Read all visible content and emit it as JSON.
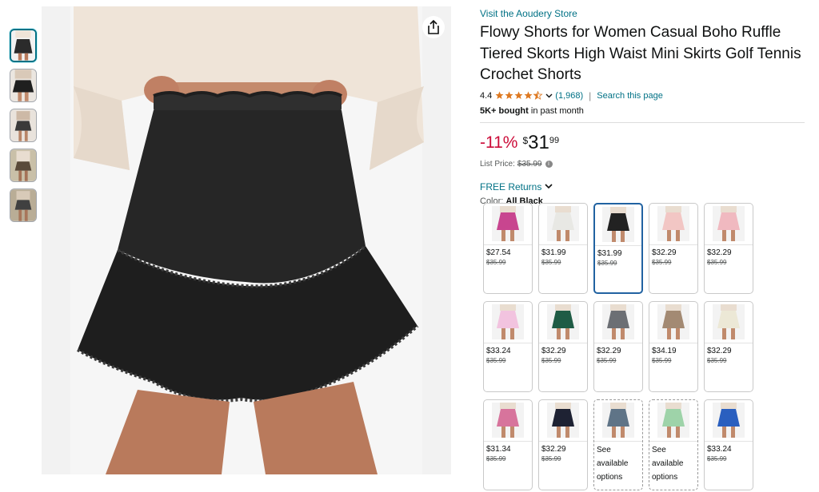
{
  "thumbnails": [
    {
      "color": "#2b2b2b"
    },
    {
      "color": "#1f1f1f"
    },
    {
      "color": "#3a3a3a"
    },
    {
      "color": "#5a4a3a"
    },
    {
      "color": "#404040"
    }
  ],
  "main_image": {
    "skirt_color": "#262626",
    "top_color": "#efe4d8",
    "skin_color": "#b97a5c",
    "bg_color": "#f2f2f2"
  },
  "product": {
    "store_link": "Visit the Aoudery Store",
    "title": "Flowy Shorts for Women Casual Boho Ruffle Tiered Skorts High Waist Mini Skirts Golf Tennis Crochet Shorts",
    "rating": "4.4",
    "rating_count": "(1,968)",
    "search_link": "Search this page",
    "bought_bold": "5K+ bought",
    "bought_rest": " in past month",
    "discount": "-11%",
    "price_symbol": "$",
    "price_whole": "31",
    "price_fraction": "99",
    "list_price_label": "List Price:",
    "list_price": "$35.99",
    "free_returns": "FREE Returns",
    "color_label": "Color:",
    "color_value": "All Black"
  },
  "colors": {
    "link": "#007185",
    "discount": "#cc0c39",
    "star": "#de7921",
    "selected": "#2162a1"
  },
  "swatches": [
    {
      "color": "#c8458f",
      "price": "$27.54",
      "old": "$35.99",
      "selected": false,
      "see": false
    },
    {
      "color": "#e8e8e4",
      "price": "$31.99",
      "old": "$35.99",
      "selected": false,
      "see": false
    },
    {
      "color": "#222222",
      "price": "$31.99",
      "old": "$35.99",
      "selected": true,
      "see": false
    },
    {
      "color": "#f2c6c4",
      "price": "$32.29",
      "old": "$35.99",
      "selected": false,
      "see": false
    },
    {
      "color": "#f0b9c0",
      "price": "$32.29",
      "old": "$35.99",
      "selected": false,
      "see": false
    },
    {
      "color": "#f2c3df",
      "price": "$33.24",
      "old": "$35.99",
      "selected": false,
      "see": false
    },
    {
      "color": "#1f5c45",
      "price": "$32.29",
      "old": "$35.99",
      "selected": false,
      "see": false
    },
    {
      "color": "#6c6f74",
      "price": "$32.29",
      "old": "$35.99",
      "selected": false,
      "see": false
    },
    {
      "color": "#a38a73",
      "price": "$34.19",
      "old": "$35.99",
      "selected": false,
      "see": false
    },
    {
      "color": "#ece8d6",
      "price": "$32.29",
      "old": "$35.99",
      "selected": false,
      "see": false
    },
    {
      "color": "#d7749c",
      "price": "$31.34",
      "old": "$35.99",
      "selected": false,
      "see": false
    },
    {
      "color": "#1e2233",
      "price": "$32.29",
      "old": "$35.99",
      "selected": false,
      "see": false
    },
    {
      "color": "#5f7487",
      "price": "See available options",
      "old": "",
      "selected": false,
      "see": true
    },
    {
      "color": "#9ed3a9",
      "price": "See available options",
      "old": "",
      "selected": false,
      "see": true
    },
    {
      "color": "#2a5fbf",
      "price": "$33.24",
      "old": "$35.99",
      "selected": false,
      "see": false
    }
  ]
}
